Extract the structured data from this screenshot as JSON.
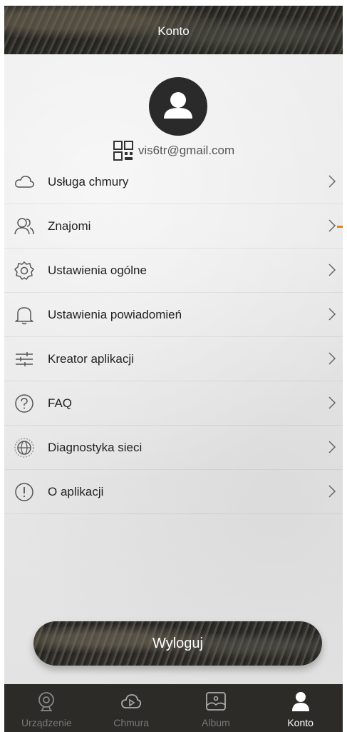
{
  "header": {
    "title": "Konto"
  },
  "profile": {
    "email": "vis6tr@gmail.com"
  },
  "menu": [
    {
      "label": "Usługa chmury",
      "icon": "cloud-icon"
    },
    {
      "label": "Znajomi",
      "icon": "friends-icon"
    },
    {
      "label": "Ustawienia ogólne",
      "icon": "gear-icon"
    },
    {
      "label": "Ustawienia powiadomień",
      "icon": "bell-icon"
    },
    {
      "label": "Kreator aplikacji",
      "icon": "sliders-icon"
    },
    {
      "label": "FAQ",
      "icon": "question-icon"
    },
    {
      "label": "Diagnostyka sieci",
      "icon": "globe-icon"
    },
    {
      "label": "O aplikacji",
      "icon": "info-icon"
    }
  ],
  "logout_label": "Wyloguj",
  "tabs": [
    {
      "label": "Urządzenie",
      "icon": "device-icon",
      "active": false
    },
    {
      "label": "Chmura",
      "icon": "cloud-play-icon",
      "active": false
    },
    {
      "label": "Album",
      "icon": "album-icon",
      "active": false
    },
    {
      "label": "Konto",
      "icon": "user-icon",
      "active": true
    }
  ],
  "colors": {
    "accent_marker": "#e6801c",
    "tabbar_bg": "#2c2b28"
  }
}
